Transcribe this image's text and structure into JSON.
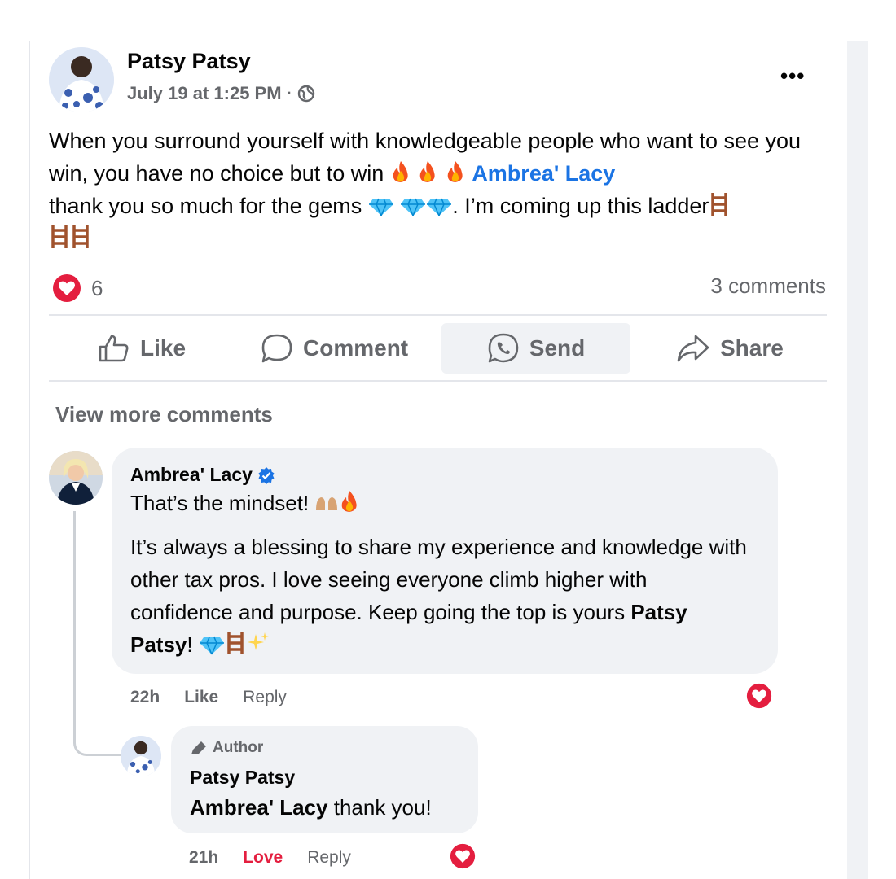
{
  "post": {
    "author": "Patsy Patsy",
    "time": "July 19 at 1:25 PM ·",
    "text_1": "When you surround yourself with knowledgeable people who want to see you win, you have no choice but to win",
    "mention": "Ambrea' Lacy",
    "text_2": "thank you so much for the gems",
    "text_3": ". I’m coming up this ladder",
    "reaction_count": "6",
    "comments_count": "3 comments"
  },
  "actions": {
    "like": "Like",
    "comment": "Comment",
    "send": "Send",
    "share": "Share"
  },
  "view_more": "View more comments",
  "comments": [
    {
      "author": "Ambrea' Lacy",
      "verified": true,
      "line_1": "That’s the mindset!",
      "line_2": "It’s always a blessing to share my experience and knowledge with other tax pros. I love seeing everyone climb higher with confidence and purpose. Keep going the top is yours",
      "mention": "Patsy Patsy",
      "line_2_end": "!",
      "time": "22h",
      "like": "Like",
      "reply": "Reply"
    },
    {
      "badge": "Author",
      "author": "Patsy Patsy",
      "mention": "Ambrea' Lacy",
      "text": "thank you!",
      "time": "21h",
      "love": "Love",
      "reply": "Reply"
    }
  ],
  "colors": {
    "love": "#e41e3f",
    "link": "#1b74e4",
    "secondary": "#65676b",
    "bubble": "#f0f2f5"
  }
}
